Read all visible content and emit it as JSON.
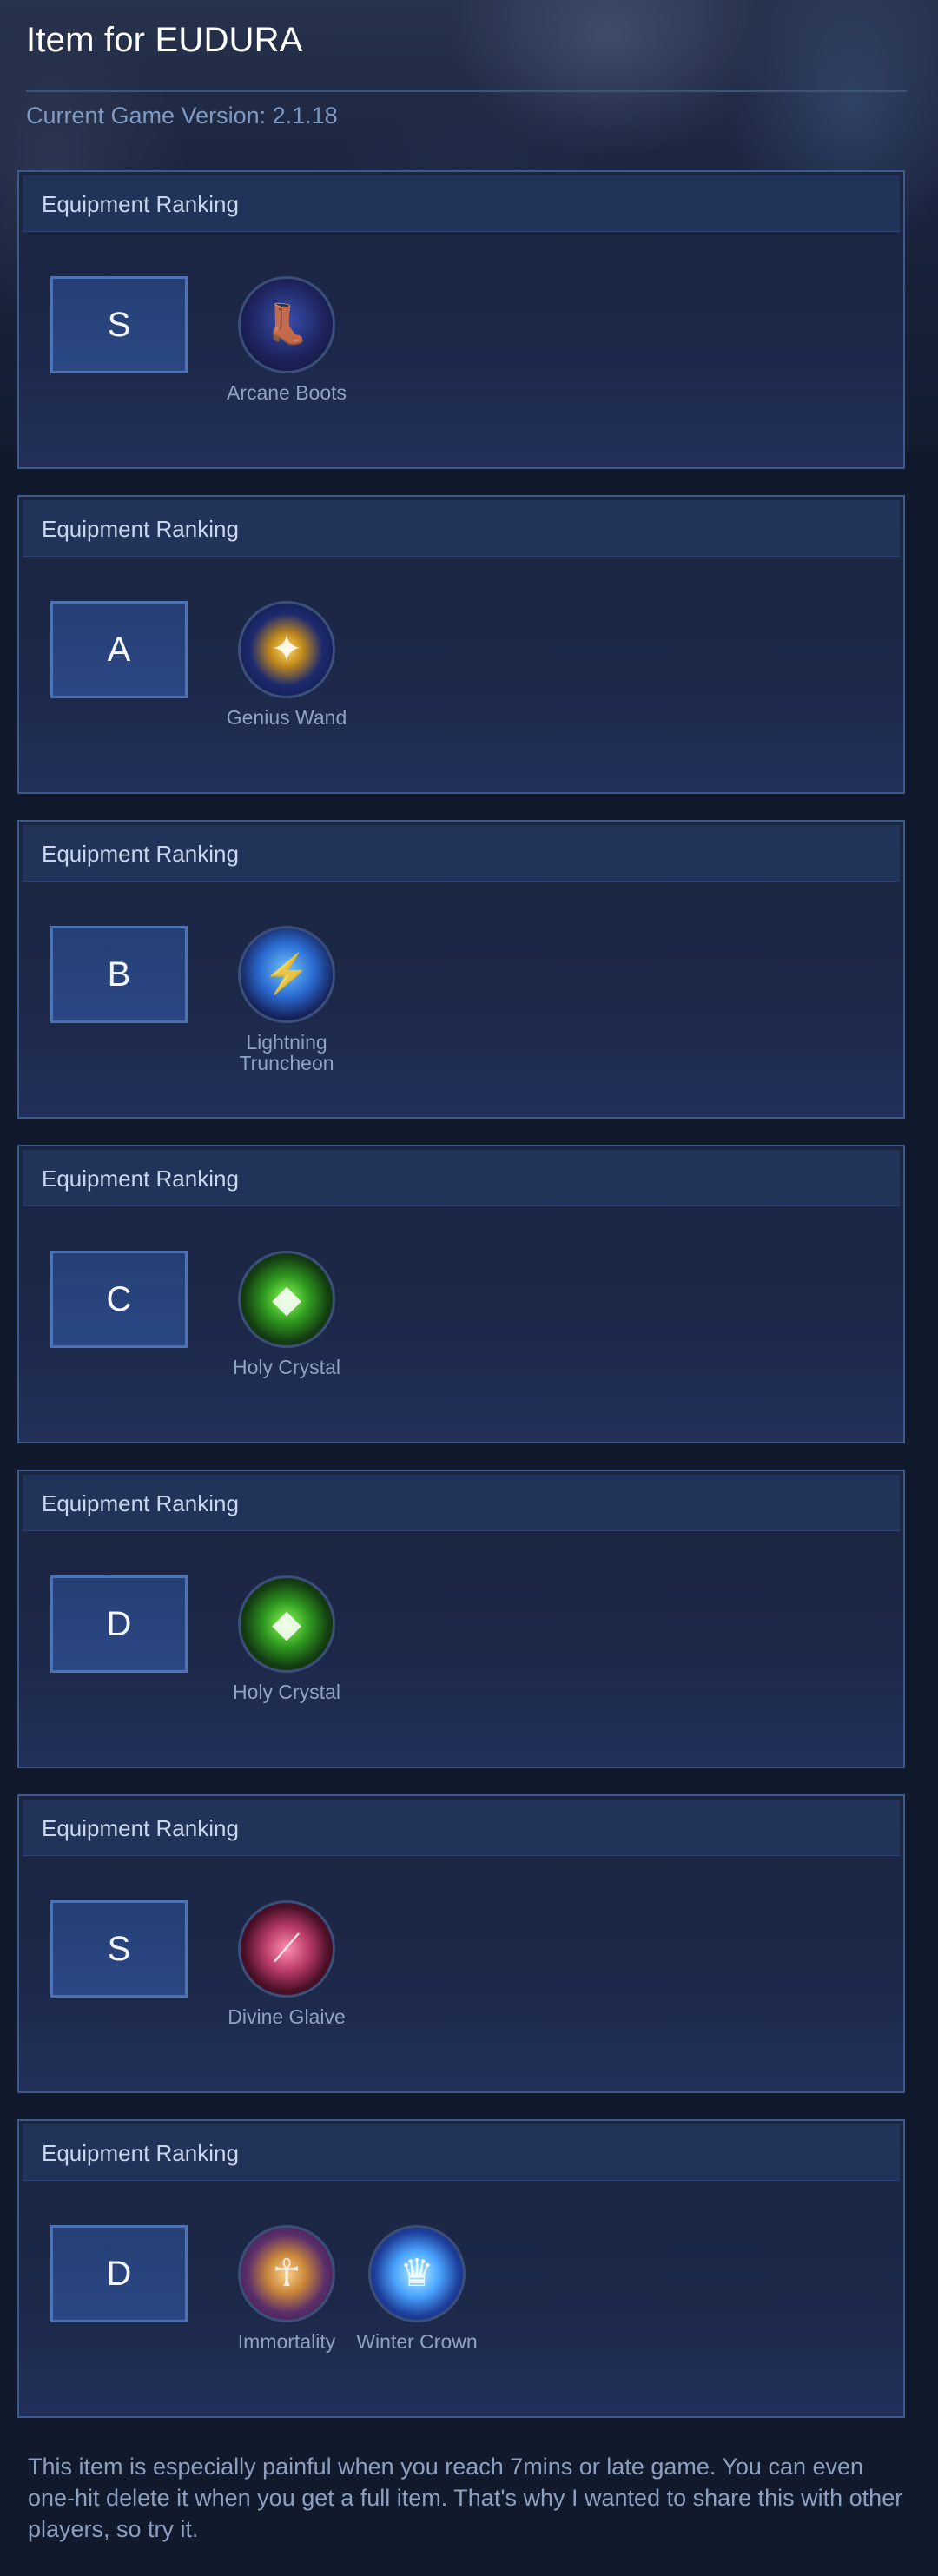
{
  "header": {
    "title": "Item for EUDURA",
    "version": "Current Game Version: 2.1.18"
  },
  "rankings": [
    {
      "heading": "Equipment Ranking",
      "rank": "S",
      "items": [
        {
          "name": "Arcane Boots",
          "icon": "boots-icon"
        }
      ]
    },
    {
      "heading": "Equipment Ranking",
      "rank": "A",
      "items": [
        {
          "name": "Genius Wand",
          "icon": "wand-icon"
        }
      ]
    },
    {
      "heading": "Equipment Ranking",
      "rank": "B",
      "items": [
        {
          "name": "Lightning Truncheon",
          "icon": "truncheon-icon"
        }
      ]
    },
    {
      "heading": "Equipment Ranking",
      "rank": "C",
      "items": [
        {
          "name": "Holy Crystal",
          "icon": "crystal-icon"
        }
      ]
    },
    {
      "heading": "Equipment Ranking",
      "rank": "D",
      "items": [
        {
          "name": "Holy Crystal",
          "icon": "crystal-icon"
        }
      ]
    },
    {
      "heading": "Equipment Ranking",
      "rank": "S",
      "items": [
        {
          "name": "Divine Glaive",
          "icon": "glaive-icon"
        }
      ]
    },
    {
      "heading": "Equipment Ranking",
      "rank": "D",
      "items": [
        {
          "name": "Immortality",
          "icon": "immortality-icon"
        },
        {
          "name": "Winter Crown",
          "icon": "crown-icon"
        }
      ]
    }
  ],
  "footer": {
    "note": "This item is especially painful when you reach 7mins or late game. You can even one-hit delete it when you get a full item. That's why I wanted to share this with other players, so try it."
  },
  "colors": {
    "background": "#111a2c",
    "card_border": "#3e5a8c",
    "rank_box": "#2b4784",
    "title": "#ffffff",
    "version_text": "#7f9ac3"
  }
}
